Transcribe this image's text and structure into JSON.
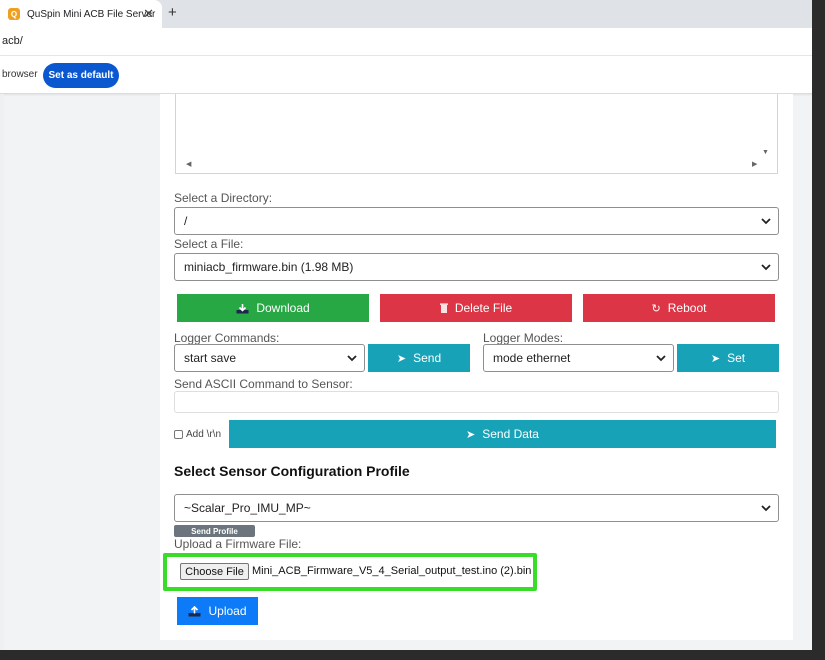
{
  "browser": {
    "tab_title": "QuSpin Mini ACB File Server",
    "tab_close": "✕",
    "new_tab": "+",
    "address": "acb/",
    "infobar_text": "browser",
    "set_default_label": "Set as default"
  },
  "directory": {
    "label": "Select a Directory:",
    "value": "/"
  },
  "file": {
    "label": "Select a File:",
    "value": "miniacb_firmware.bin (1.98 MB)"
  },
  "actions": {
    "download": "Download",
    "delete": "Delete File",
    "reboot": "Reboot"
  },
  "logger": {
    "commands_label": "Logger Commands:",
    "command_value": "start save",
    "send_label": "Send",
    "modes_label": "Logger Modes:",
    "mode_value": "mode ethernet",
    "set_label": "Set"
  },
  "ascii": {
    "label": "Send ASCII Command to Sensor:",
    "value": "",
    "add_rn_label": "Add \\r\\n",
    "send_data_label": "Send Data"
  },
  "profile": {
    "title": "Select Sensor Configuration Profile",
    "value": "~Scalar_Pro_IMU_MP~",
    "send_profile_label": "Send Profile"
  },
  "firmware": {
    "label": "Upload a Firmware File:",
    "choose_label": "Choose File",
    "file_name": "Mini_ACB_Firmware_V5_4_Serial_output_test.ino (2).bin",
    "upload_label": "Upload"
  },
  "colors": {
    "green": "#28a745",
    "red": "#dc3545",
    "teal": "#17a2b8",
    "blue": "#0d7bf7",
    "highlight": "#3adc2a"
  },
  "icons": {
    "download": "download-icon",
    "delete": "trash-icon",
    "reboot": "reload-icon",
    "send": "send-arrow-icon",
    "upload": "upload-icon"
  }
}
